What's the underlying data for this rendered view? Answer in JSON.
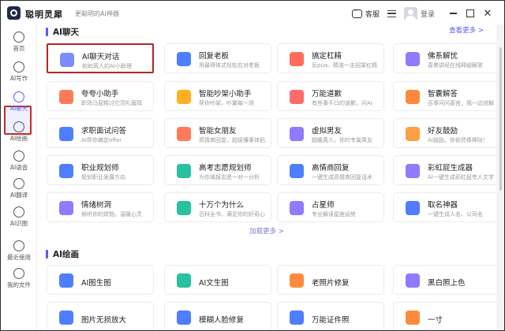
{
  "app": {
    "name": "聪明灵犀",
    "slogan": "更聪明的AI神器"
  },
  "titlebar": {
    "service_label": "客服",
    "login_label": "登录",
    "close_glyph": "✕"
  },
  "sidebar": {
    "items": [
      {
        "label": "首页",
        "icon": "home-icon"
      },
      {
        "label": "AI写作",
        "icon": "pen-icon"
      },
      {
        "label": "AI聊天",
        "icon": "chat-icon",
        "active": true
      },
      {
        "label": "AI绘画",
        "icon": "brush-icon"
      },
      {
        "label": "AI语音",
        "icon": "headphones-icon"
      },
      {
        "label": "AI翻译",
        "icon": "translate-icon"
      },
      {
        "label": "AI识图",
        "icon": "image-recognition-icon"
      },
      {
        "label": "最近使用",
        "icon": "recent-icon"
      },
      {
        "label": "我的文件",
        "icon": "file-icon"
      }
    ]
  },
  "chat_section": {
    "title": "AI聊天",
    "see_more": "查看更多 >",
    "load_more": "加载更多 >",
    "cards": [
      {
        "title": "AI聊天对话",
        "desc": "和如真人的AI小助理",
        "color": "#7b8cff"
      },
      {
        "title": "回复老板",
        "desc": "用最得体式轻松应对老板",
        "color": "#4f7dff"
      },
      {
        "title": "搞定杠精",
        "desc": "反pua、精准一击招架杠精",
        "color": "#ff6b5b"
      },
      {
        "title": "佛系解忧",
        "desc": "喜佛讲经在线释疑解答",
        "color": "#8e7bff"
      },
      {
        "title": "夸夸小助手",
        "desc": "职场马屁精讨它顶礼膜拜",
        "color": "#ff7a59"
      },
      {
        "title": "智能吵架小助手",
        "desc": "帮你吵架，吵赢每一场",
        "color": "#ffb020"
      },
      {
        "title": "万能道歉",
        "desc": "有些事不口的道歉，问AI",
        "color": "#ff6b6b"
      },
      {
        "title": "智囊解答",
        "desc": "百事问问喜宫，我一边进解",
        "color": "#ff8a3d"
      },
      {
        "title": "求职面试问答",
        "desc": "AI帮你搞定offer",
        "color": "#4f7dff"
      },
      {
        "title": "智能女朋友",
        "desc": "高情商回复，超级懂事体贴",
        "color": "#ff7a59"
      },
      {
        "title": "虚拟男友",
        "desc": "超暖真人，你的专属男友",
        "color": "#8e7bff"
      },
      {
        "title": "好友鼓励",
        "desc": "AI鼓励，你依然棒棒哒！",
        "color": "#ff9f43"
      },
      {
        "title": "职业规划师",
        "desc": "规划职业发展方向",
        "color": "#4f7dff"
      },
      {
        "title": "高考志愿规划师",
        "desc": "为你填报志愿一对一分析",
        "color": "#2bc0a0"
      },
      {
        "title": "高情商回复",
        "desc": "一键生成高情商回复话术",
        "color": "#4f7dff"
      },
      {
        "title": "彩虹屁生成器",
        "desc": "AI一键生成彩虹屁夸人文字",
        "color": "#8e7bff"
      },
      {
        "title": "情绪树洞",
        "desc": "倾听你的烦恼，温暖心灵",
        "color": "#8e7bff"
      },
      {
        "title": "十万个为什么",
        "desc": "百科全书，满足你的好奇心",
        "color": "#2bc0a0"
      },
      {
        "title": "占星师",
        "desc": "专业解读星座运势",
        "color": "#8e7bff"
      },
      {
        "title": "取名神器",
        "desc": "一键生成人名、公司名",
        "color": "#4f7dff"
      }
    ]
  },
  "draw_section": {
    "title": "AI绘画",
    "cards": [
      {
        "title": "AI图生图",
        "color": "#4f7dff"
      },
      {
        "title": "AI文生图",
        "color": "#2bc0a0"
      },
      {
        "title": "老照片修复",
        "color": "#ff8a3d"
      },
      {
        "title": "黑白照上色",
        "color": "#8e7bff"
      },
      {
        "title": "图片无损放大",
        "color": "#4f7dff"
      },
      {
        "title": "模糊人脸修复",
        "color": "#4f7dff"
      },
      {
        "title": "万能证件照",
        "color": "#4f7dff"
      },
      {
        "title": "一寸",
        "color": "#ff8a3d"
      }
    ]
  }
}
